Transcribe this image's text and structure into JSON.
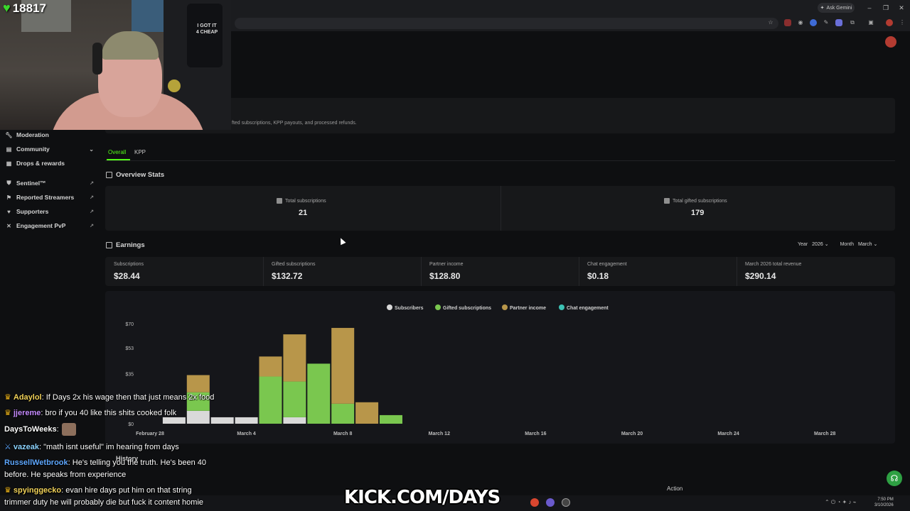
{
  "browser": {
    "ask_gemini": "Ask Gemini"
  },
  "overlay": {
    "sub_count": "18817",
    "banner": "KICK.COM/DAYS",
    "shirt_text": "I GOT IT 4 CHEAP"
  },
  "sidebar": {
    "items": [
      {
        "label": "Moderation",
        "icon": "wrench-icon"
      },
      {
        "label": "Community",
        "icon": "people-icon"
      },
      {
        "label": "Drops & rewards",
        "icon": "gift-icon"
      },
      {
        "label": "Sentinel™",
        "icon": "shield-icon"
      },
      {
        "label": "Reported Streamers",
        "icon": "flag-icon"
      },
      {
        "label": "Supporters",
        "icon": "heart-icon"
      },
      {
        "label": "Engagement PvP",
        "icon": "swords-icon"
      }
    ]
  },
  "header": {
    "info_text": "fted subscriptions, KPP payouts, and processed refunds."
  },
  "tabs": [
    "Overall",
    "KPP"
  ],
  "overview": {
    "title": "Overview Stats",
    "total_subscriptions_label": "Total subscriptions",
    "total_subscriptions": "21",
    "total_gifted_label": "Total gifted subscriptions",
    "total_gifted": "179"
  },
  "earnings": {
    "title": "Earnings",
    "year_label": "Year",
    "year_value": "2026",
    "month_label": "Month",
    "month_value": "March",
    "cells": [
      {
        "label": "Subscriptions",
        "value": "$28.44"
      },
      {
        "label": "Gifted subscriptions",
        "value": "$132.72"
      },
      {
        "label": "Partner income",
        "value": "$128.80"
      },
      {
        "label": "Chat engagement",
        "value": "$0.18"
      },
      {
        "label": "March 2026 total revenue",
        "value": "$290.14"
      }
    ]
  },
  "colors": {
    "accent": "#53fc18",
    "subscribers": "#d9d9d9",
    "gifted": "#7ac74f",
    "partner": "#b8964a",
    "chat": "#3cc2b4"
  },
  "chart_data": {
    "type": "bar",
    "stacked": true,
    "legend_position": "top-center",
    "y_ticks": [
      "$70",
      "$53",
      "$35",
      "$0"
    ],
    "ylim": [
      0,
      70
    ],
    "x_tick_labels": [
      "February 28",
      "March 4",
      "March 8",
      "March 12",
      "March 16",
      "March 20",
      "March 24",
      "March 28"
    ],
    "categories": [
      "Feb 28",
      "Mar 1",
      "Mar 2",
      "Mar 3",
      "Mar 4",
      "Mar 5",
      "Mar 6",
      "Mar 7",
      "Mar 8",
      "Mar 9",
      "Mar 10"
    ],
    "series": [
      {
        "name": "Subscribers",
        "values": [
          0,
          4.5,
          9,
          4.5,
          4.5,
          0,
          4.5,
          0,
          0,
          0,
          0
        ]
      },
      {
        "name": "Gifted subscriptions",
        "values": [
          0,
          0,
          13,
          0,
          0,
          33,
          25,
          42,
          14,
          0,
          6
        ]
      },
      {
        "name": "Partner income",
        "values": [
          0,
          0,
          12,
          0,
          0,
          14,
          33,
          0,
          53,
          15,
          0
        ]
      },
      {
        "name": "Chat engagement",
        "values": [
          0,
          0,
          0,
          0,
          0,
          0,
          0,
          0,
          0,
          0,
          0
        ]
      }
    ]
  },
  "history": {
    "title": "History",
    "action_label": "Action"
  },
  "chat": [
    {
      "badge": "crown",
      "user": "Adaylol",
      "color": "#f2d35a",
      "text": ": If Days 2x his wage then that just means 2x food"
    },
    {
      "badge": "crown",
      "user": "jjereme",
      "color": "#c58bff",
      "text": ": bro if you 40 like this shits cooked folk"
    },
    {
      "badge": "",
      "user": "DaysToWeeks",
      "color": "#ffffff",
      "text": ":"
    },
    {
      "badge": "sword",
      "user": "vazeak",
      "color": "#8cd3ff",
      "text": ": \"math isnt useful\" im hearing from days"
    },
    {
      "badge": "",
      "user": "RussellWetbrook",
      "color": "#5fa8ff",
      "text": ": He's telling you the truth. He's been 40"
    },
    {
      "badge": "",
      "user": "",
      "color": "#ffffff",
      "text": "before. He speaks from experience"
    },
    {
      "badge": "crown",
      "user": "spyinggecko",
      "color": "#f2d35a",
      "text": ": evan hire days put him on that string"
    },
    {
      "badge": "",
      "user": "",
      "color": "#ffffff",
      "text": "trimmer duty he will probably die but fuck it content homie"
    }
  ],
  "taskbar": {
    "time": "7:50 PM",
    "date": "3/10/2026"
  }
}
